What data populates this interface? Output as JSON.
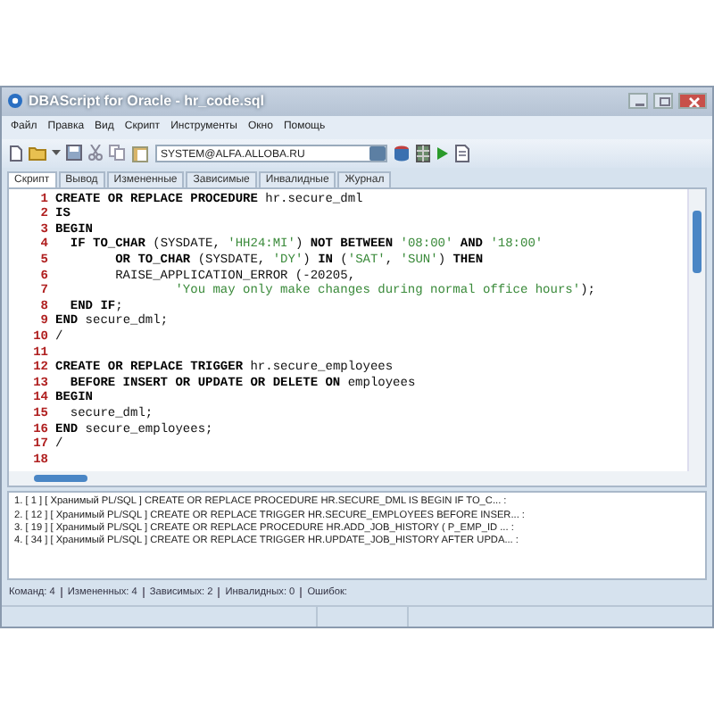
{
  "window": {
    "title": "DBAScript for Oracle - hr_code.sql"
  },
  "menu": [
    "Файл",
    "Правка",
    "Вид",
    "Скрипт",
    "Инструменты",
    "Окно",
    "Помощь"
  ],
  "toolbar": {
    "connection": "SYSTEM@ALFA.ALLOBA.RU"
  },
  "tabs": [
    {
      "label": "Скрипт",
      "selected": true
    },
    {
      "label": "Вывод",
      "selected": false
    },
    {
      "label": "Измененные",
      "selected": false
    },
    {
      "label": "Зависимые",
      "selected": false
    },
    {
      "label": "Инвалидные",
      "selected": false
    },
    {
      "label": "Журнал",
      "selected": false
    }
  ],
  "editor": {
    "lines": [
      {
        "number": "1",
        "segments": [
          {
            "kind": "keyword",
            "text": "CREATE OR REPLACE PROCEDURE"
          },
          {
            "kind": "plain",
            "text": " hr.secure_dml"
          }
        ]
      },
      {
        "number": "2",
        "segments": [
          {
            "kind": "keyword",
            "text": "IS"
          }
        ]
      },
      {
        "number": "3",
        "segments": [
          {
            "kind": "keyword",
            "text": "BEGIN"
          }
        ]
      },
      {
        "number": "4",
        "segments": [
          {
            "kind": "keyword",
            "text": "  IF TO_CHAR"
          },
          {
            "kind": "plain",
            "text": " (SYSDATE, "
          },
          {
            "kind": "string",
            "text": "'HH24:MI'"
          },
          {
            "kind": "plain",
            "text": ") "
          },
          {
            "kind": "keyword",
            "text": "NOT BETWEEN "
          },
          {
            "kind": "string",
            "text": "'08:00'"
          },
          {
            "kind": "keyword",
            "text": " AND "
          },
          {
            "kind": "string",
            "text": "'18:00'"
          }
        ]
      },
      {
        "number": "5",
        "segments": [
          {
            "kind": "keyword",
            "text": "        OR TO_CHAR"
          },
          {
            "kind": "plain",
            "text": " (SYSDATE, "
          },
          {
            "kind": "string",
            "text": "'DY'"
          },
          {
            "kind": "plain",
            "text": ") "
          },
          {
            "kind": "keyword",
            "text": "IN"
          },
          {
            "kind": "plain",
            "text": " ("
          },
          {
            "kind": "string",
            "text": "'SAT'"
          },
          {
            "kind": "plain",
            "text": ", "
          },
          {
            "kind": "string",
            "text": "'SUN'"
          },
          {
            "kind": "plain",
            "text": ") "
          },
          {
            "kind": "keyword",
            "text": "THEN"
          }
        ]
      },
      {
        "number": "6",
        "segments": [
          {
            "kind": "plain",
            "text": "        RAISE_APPLICATION_ERROR (-20205,"
          }
        ]
      },
      {
        "number": "7",
        "segments": [
          {
            "kind": "string",
            "text": "                'You may only make changes during normal office hours'"
          },
          {
            "kind": "plain",
            "text": ");"
          }
        ]
      },
      {
        "number": "8",
        "segments": [
          {
            "kind": "keyword",
            "text": "  END IF"
          },
          {
            "kind": "plain",
            "text": ";"
          }
        ]
      },
      {
        "number": "9",
        "segments": [
          {
            "kind": "keyword",
            "text": "END"
          },
          {
            "kind": "plain",
            "text": " secure_dml;"
          }
        ]
      },
      {
        "number": "10",
        "segments": [
          {
            "kind": "plain",
            "text": "/"
          }
        ]
      },
      {
        "number": "11"
      },
      {
        "number": "12",
        "segments": [
          {
            "kind": "keyword",
            "text": "CREATE OR REPLACE TRIGGER"
          },
          {
            "kind": "plain",
            "text": " hr.secure_employees"
          }
        ]
      },
      {
        "number": "13",
        "segments": [
          {
            "kind": "keyword",
            "text": "  BEFORE INSERT OR UPDATE OR DELETE ON"
          },
          {
            "kind": "plain",
            "text": " employees"
          }
        ]
      },
      {
        "number": "14",
        "segments": [
          {
            "kind": "keyword",
            "text": "BEGIN"
          }
        ]
      },
      {
        "number": "15",
        "segments": [
          {
            "kind": "plain",
            "text": "  secure_dml;"
          }
        ]
      },
      {
        "number": "16",
        "segments": [
          {
            "kind": "keyword",
            "text": "END"
          },
          {
            "kind": "plain",
            "text": " secure_employees;"
          }
        ]
      },
      {
        "number": "17",
        "segments": [
          {
            "kind": "plain",
            "text": "/"
          }
        ]
      },
      {
        "number": "18"
      }
    ]
  },
  "output": [
    "1. [ 1 ] [ Хранимый PL/SQL ] CREATE OR REPLACE PROCEDURE HR.SECURE_DML IS BEGIN IF TO_C... :",
    "2. [ 12 ] [ Хранимый PL/SQL ] CREATE OR REPLACE TRIGGER HR.SECURE_EMPLOYEES BEFORE INSER... :",
    "3. [ 19 ] [ Хранимый PL/SQL ] CREATE OR REPLACE PROCEDURE HR.ADD_JOB_HISTORY ( P_EMP_ID ... :",
    "4. [ 34 ] [ Хранимый PL/SQL ] CREATE OR REPLACE TRIGGER HR.UPDATE_JOB_HISTORY AFTER UPDA... :"
  ],
  "summary": [
    "Команд: 4",
    "Измененных: 4",
    "Зависимых: 2",
    "Инвалидных: 0",
    "Ошибок:"
  ]
}
